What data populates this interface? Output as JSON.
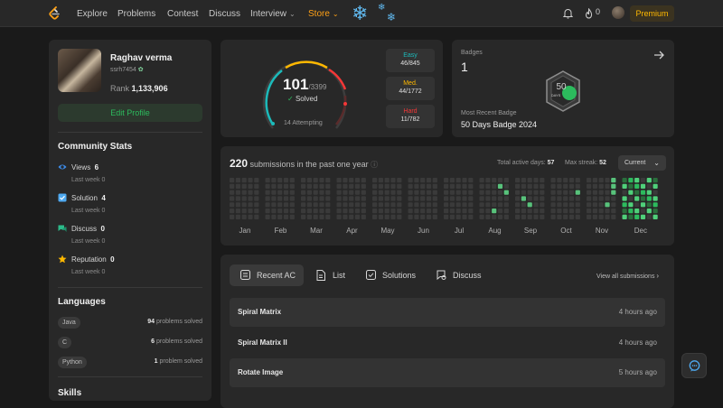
{
  "nav": {
    "items": [
      "Explore",
      "Problems",
      "Contest",
      "Discuss",
      "Interview",
      "Store"
    ],
    "notification_count": "0",
    "premium_label": "Premium"
  },
  "profile": {
    "name": "Raghav verma",
    "username": "ssrh7454",
    "rank_label": "Rank",
    "rank_value": "1,133,906",
    "edit_label": "Edit Profile"
  },
  "community": {
    "title": "Community Stats",
    "stats": [
      {
        "label": "Views",
        "value": "6",
        "sub": "Last week 0",
        "color": "#3c8be8"
      },
      {
        "label": "Solution",
        "value": "4",
        "sub": "Last week 0",
        "color": "#4ea9f0"
      },
      {
        "label": "Discuss",
        "value": "0",
        "sub": "Last week 0",
        "color": "#2cbb8a"
      },
      {
        "label": "Reputation",
        "value": "0",
        "sub": "Last week 0",
        "color": "#ffb800"
      }
    ]
  },
  "languages": {
    "title": "Languages",
    "items": [
      {
        "name": "Java",
        "count": "94",
        "suffix": "problems solved"
      },
      {
        "name": "C",
        "count": "6",
        "suffix": "problems solved"
      },
      {
        "name": "Python",
        "count": "1",
        "suffix": "problem solved"
      }
    ]
  },
  "skills": {
    "title": "Skills"
  },
  "solved": {
    "solved": "101",
    "total": "/3399",
    "solved_label": "Solved",
    "attempting": "14 Attempting",
    "difficulties": [
      {
        "label": "Easy",
        "value": "46/845",
        "color": "#1cbaba"
      },
      {
        "label": "Med.",
        "value": "44/1772",
        "color": "#ffb800"
      },
      {
        "label": "Hard",
        "value": "11/782",
        "color": "#f63737"
      }
    ]
  },
  "badges": {
    "title": "Badges",
    "count": "1",
    "recent_label": "Most Recent Badge",
    "recent_name": "50 Days Badge 2024",
    "badge_text": "50",
    "badge_sub": "DAYS"
  },
  "submissions": {
    "count": "220",
    "text": "submissions in the past one year",
    "active_label": "Total active days:",
    "active_value": "57",
    "streak_label": "Max streak:",
    "streak_value": "52",
    "period": "Current",
    "months": [
      "Jan",
      "Feb",
      "Mar",
      "Apr",
      "May",
      "Jun",
      "Jul",
      "Aug",
      "Sep",
      "Oct",
      "Nov",
      "Dec"
    ]
  },
  "recent": {
    "tabs": [
      "Recent AC",
      "List",
      "Solutions",
      "Discuss"
    ],
    "view_all": "View all submissions",
    "items": [
      {
        "title": "Spiral Matrix",
        "time": "4 hours ago"
      },
      {
        "title": "Spiral Matrix II",
        "time": "4 hours ago"
      },
      {
        "title": "Rotate Image",
        "time": "5 hours ago"
      }
    ]
  },
  "colors": {
    "accent": "#ffa116",
    "green": "#2cbb5d",
    "card": "#282828",
    "bg": "#1a1a1a"
  }
}
